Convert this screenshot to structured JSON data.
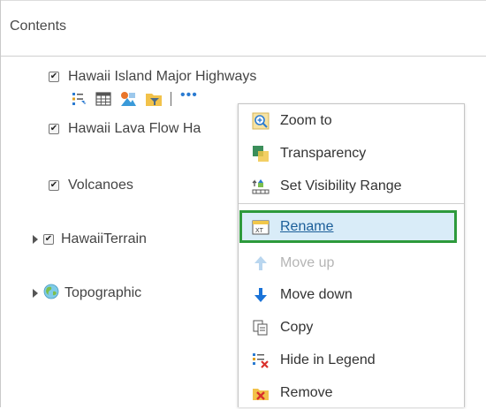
{
  "header": {
    "title": "Contents"
  },
  "layers": [
    {
      "label": "Hawaii Island Major Highways",
      "checked": true
    },
    {
      "label": "Hawaii Lava Flow Ha",
      "checked": true
    },
    {
      "label": "Volcanoes",
      "checked": true
    },
    {
      "label": "HawaiiTerrain",
      "checked": true
    },
    {
      "label": "Topographic"
    }
  ],
  "tools": {
    "icons": [
      "legend-icon",
      "table-icon",
      "change-style-icon",
      "filter-icon",
      "more-options-icon"
    ],
    "more_label": "•••"
  },
  "menu": {
    "items": [
      {
        "label": "Zoom to",
        "icon": "zoom-to-icon",
        "enabled": true
      },
      {
        "label": "Transparency",
        "icon": "transparency-icon",
        "enabled": true
      },
      {
        "label": "Set Visibility Range",
        "icon": "visibility-range-icon",
        "enabled": true
      },
      {
        "label": "Rename",
        "icon": "rename-icon",
        "enabled": true,
        "highlighted": true
      },
      {
        "label": "Move up",
        "icon": "arrow-up-icon",
        "enabled": false
      },
      {
        "label": "Move down",
        "icon": "arrow-down-icon",
        "enabled": true
      },
      {
        "label": "Copy",
        "icon": "copy-icon",
        "enabled": true
      },
      {
        "label": "Hide in Legend",
        "icon": "hide-legend-icon",
        "enabled": true
      },
      {
        "label": "Remove",
        "icon": "remove-icon",
        "enabled": true
      }
    ]
  },
  "colors": {
    "highlight_border": "#2d9a3c",
    "highlight_fill": "#d9ecf8",
    "link_blue": "#1b5e99",
    "arrow_blue": "#1a73d8"
  }
}
